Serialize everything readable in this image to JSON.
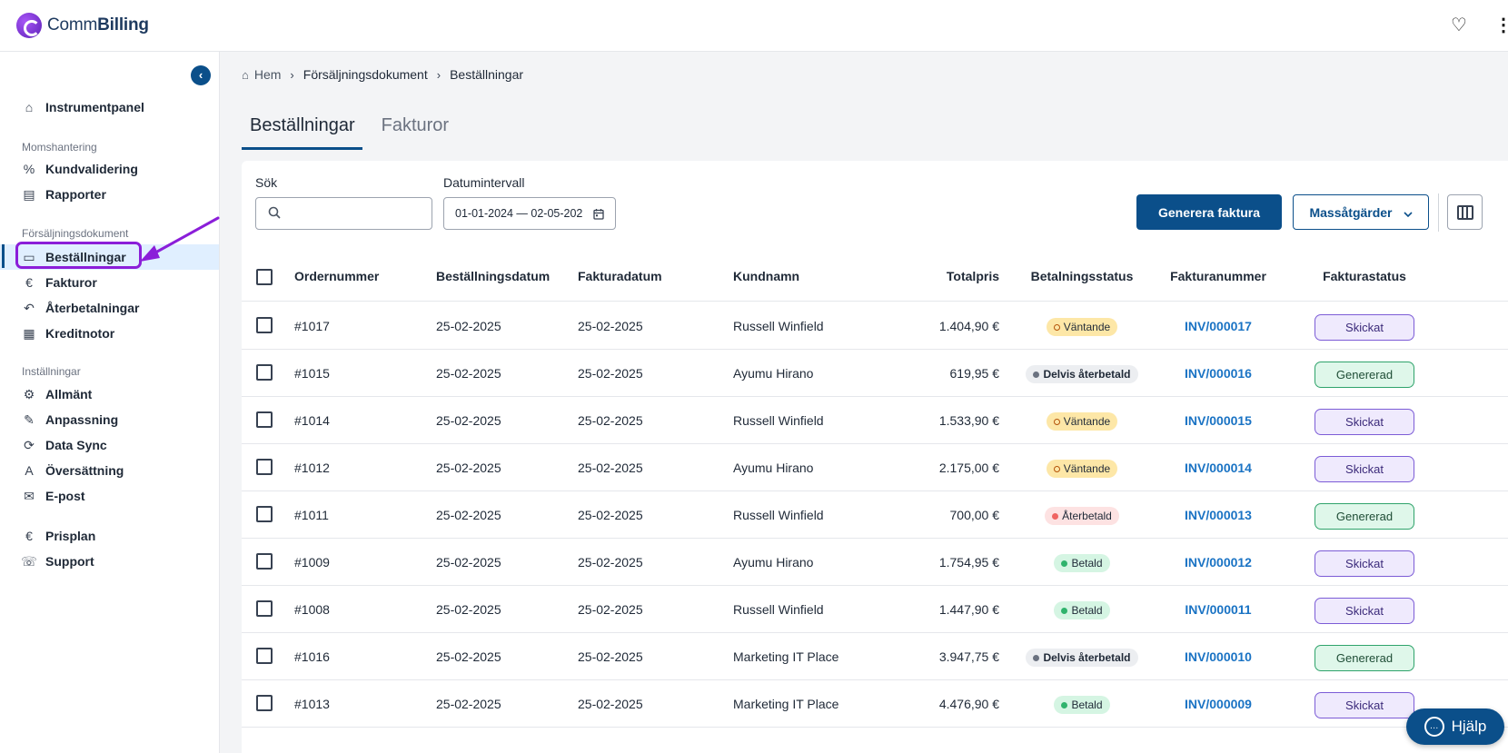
{
  "app": {
    "name_light": "Comm",
    "name_bold": "Billing",
    "heart_icon": "♡",
    "more_icon": "⋮"
  },
  "sidebar": {
    "collapse_icon": "‹",
    "items": [
      {
        "label": "Instrumentpanel",
        "icon": "⌂"
      },
      {
        "label": "Kundvalidering",
        "icon": "%"
      },
      {
        "label": "Rapporter",
        "icon": "▤"
      },
      {
        "label": "Beställningar",
        "icon": "▭"
      },
      {
        "label": "Fakturor",
        "icon": "€"
      },
      {
        "label": "Återbetalningar",
        "icon": "↶"
      },
      {
        "label": "Kreditnotor",
        "icon": "▦"
      },
      {
        "label": "Allmänt",
        "icon": "⚙"
      },
      {
        "label": "Anpassning",
        "icon": "✎"
      },
      {
        "label": "Data Sync",
        "icon": "⟳"
      },
      {
        "label": "Översättning",
        "icon": "A"
      },
      {
        "label": "E-post",
        "icon": "✉"
      },
      {
        "label": "Prisplan",
        "icon": "€"
      },
      {
        "label": "Support",
        "icon": "☏"
      }
    ],
    "sections": {
      "tax": "Momshantering",
      "sales": "Försäljningsdokument",
      "settings": "Inställningar"
    }
  },
  "breadcrumb": {
    "home": "Hem",
    "level1": "Försäljningsdokument",
    "level2": "Beställningar"
  },
  "tabs": [
    {
      "label": "Beställningar",
      "active": true
    },
    {
      "label": "Fakturor",
      "active": false
    }
  ],
  "filters": {
    "search_label": "Sök",
    "search_value": "",
    "date_label": "Datumintervall",
    "date_value": "01-01-2024 — 02-05-202"
  },
  "actions": {
    "generate": "Generera faktura",
    "bulk": "Massåtgärder"
  },
  "table": {
    "headers": [
      "Ordernummer",
      "Beställningsdatum",
      "Fakturadatum",
      "Kundnamn",
      "Totalpris",
      "Betalningsstatus",
      "Fakturanummer",
      "Fakturastatus"
    ],
    "rows": [
      {
        "order": "#1017",
        "order_date": "25-02-2025",
        "invoice_date": "25-02-2025",
        "customer": "Russell Winfield",
        "total": "1.404,90 €",
        "pay": "Väntande",
        "pay_kind": "pending",
        "invoice": "INV/000017",
        "status": "Skickat",
        "status_kind": "sent"
      },
      {
        "order": "#1015",
        "order_date": "25-02-2025",
        "invoice_date": "25-02-2025",
        "customer": "Ayumu Hirano",
        "total": "619,95 €",
        "pay": "Delvis återbetald",
        "pay_kind": "partial",
        "invoice": "INV/000016",
        "status": "Genererad",
        "status_kind": "gen"
      },
      {
        "order": "#1014",
        "order_date": "25-02-2025",
        "invoice_date": "25-02-2025",
        "customer": "Russell Winfield",
        "total": "1.533,90 €",
        "pay": "Väntande",
        "pay_kind": "pending",
        "invoice": "INV/000015",
        "status": "Skickat",
        "status_kind": "sent"
      },
      {
        "order": "#1012",
        "order_date": "25-02-2025",
        "invoice_date": "25-02-2025",
        "customer": "Ayumu Hirano",
        "total": "2.175,00 €",
        "pay": "Väntande",
        "pay_kind": "pending",
        "invoice": "INV/000014",
        "status": "Skickat",
        "status_kind": "sent"
      },
      {
        "order": "#1011",
        "order_date": "25-02-2025",
        "invoice_date": "25-02-2025",
        "customer": "Russell Winfield",
        "total": "700,00 €",
        "pay": "Återbetald",
        "pay_kind": "refunded",
        "invoice": "INV/000013",
        "status": "Genererad",
        "status_kind": "gen"
      },
      {
        "order": "#1009",
        "order_date": "25-02-2025",
        "invoice_date": "25-02-2025",
        "customer": "Ayumu Hirano",
        "total": "1.754,95 €",
        "pay": "Betald",
        "pay_kind": "paid",
        "invoice": "INV/000012",
        "status": "Skickat",
        "status_kind": "sent"
      },
      {
        "order": "#1008",
        "order_date": "25-02-2025",
        "invoice_date": "25-02-2025",
        "customer": "Russell Winfield",
        "total": "1.447,90 €",
        "pay": "Betald",
        "pay_kind": "paid",
        "invoice": "INV/000011",
        "status": "Skickat",
        "status_kind": "sent"
      },
      {
        "order": "#1016",
        "order_date": "25-02-2025",
        "invoice_date": "25-02-2025",
        "customer": "Marketing IT Place",
        "total": "3.947,75 €",
        "pay": "Delvis återbetald",
        "pay_kind": "partial",
        "invoice": "INV/000010",
        "status": "Genererad",
        "status_kind": "gen"
      },
      {
        "order": "#1013",
        "order_date": "25-02-2025",
        "invoice_date": "25-02-2025",
        "customer": "Marketing IT Place",
        "total": "4.476,90 €",
        "pay": "Betald",
        "pay_kind": "paid",
        "invoice": "INV/000009",
        "status": "Skickat",
        "status_kind": "sent"
      }
    ]
  },
  "help": {
    "label": "Hjälp"
  },
  "colors": {
    "primary": "#0b4f8a",
    "highlight": "#8b1ed9",
    "link": "#1a73c4"
  }
}
